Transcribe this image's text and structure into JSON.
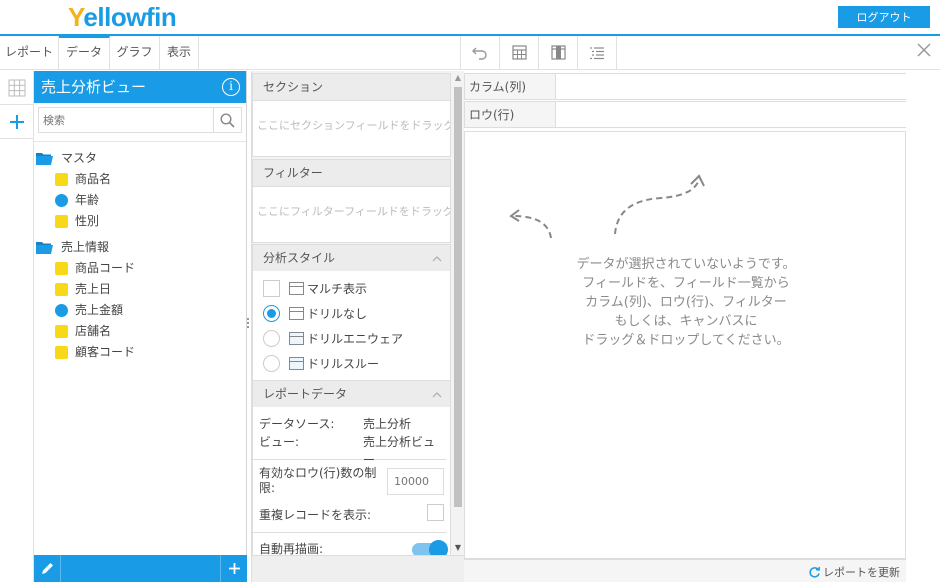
{
  "app": {
    "logo_text": "Yellowfin",
    "logout_label": "ログアウト"
  },
  "menu": {
    "tabs": [
      {
        "label": "レポート"
      },
      {
        "label": "データ"
      },
      {
        "label": "グラフ"
      },
      {
        "label": "表示"
      }
    ],
    "active_tab": "データ",
    "tools": [
      "undo-icon",
      "table-layout-icon",
      "column-layout-icon",
      "list-format-icon"
    ],
    "close_icon": "close-icon"
  },
  "view": {
    "title": "売上分析ビュー",
    "info_icon_glyph": "i",
    "search_placeholder": "検索",
    "folders": [
      {
        "name": "マスタ",
        "fields": [
          {
            "label": "商品名",
            "kind": "dimension"
          },
          {
            "label": "年齢",
            "kind": "metric"
          },
          {
            "label": "性別",
            "kind": "dimension"
          }
        ]
      },
      {
        "name": "売上情報",
        "fields": [
          {
            "label": "商品コード",
            "kind": "dimension"
          },
          {
            "label": "売上日",
            "kind": "dimension"
          },
          {
            "label": "売上金額",
            "kind": "metric"
          },
          {
            "label": "店舗名",
            "kind": "dimension"
          },
          {
            "label": "顧客コード",
            "kind": "dimension"
          }
        ]
      }
    ]
  },
  "config": {
    "section": {
      "title": "セクション",
      "placeholder": "ここにセクションフィールドをドラッグ"
    },
    "filter": {
      "title": "フィルター",
      "placeholder": "ここにフィルターフィールドをドラッグ"
    },
    "analysis_style": {
      "title": "分析スタイル",
      "multi_label": "マルチ表示",
      "options": [
        {
          "label": "ドリルなし",
          "selected": true
        },
        {
          "label": "ドリルエニウェア",
          "selected": false
        },
        {
          "label": "ドリルスルー",
          "selected": false
        }
      ]
    },
    "report_data": {
      "title": "レポートデータ",
      "datasource_label": "データソース:",
      "datasource_value": "売上分析",
      "view_label": "ビュー:",
      "view_value": "売上分析ビュー",
      "row_limit_label": "有効なロウ(行)数の制限:",
      "row_limit_value": "10000",
      "show_duplicates_label": "重複レコードを表示:",
      "auto_refresh_label": "自動再描画:",
      "auto_refresh_on": true
    }
  },
  "canvas": {
    "column_label": "カラム(列)",
    "row_label": "ロウ(行)",
    "empty_message_lines": [
      "データが選択されていないようです。",
      "フィールドを、フィールド一覧から",
      "カラム(列)、ロウ(行)、フィルター",
      "もしくは、キャンバスに",
      "ドラッグ＆ドロップしてください。"
    ],
    "refresh_label": "レポートを更新"
  },
  "colors": {
    "accent": "#1a9be6",
    "dimension": "#f7d91a",
    "logo_y": "#f5b21a"
  }
}
